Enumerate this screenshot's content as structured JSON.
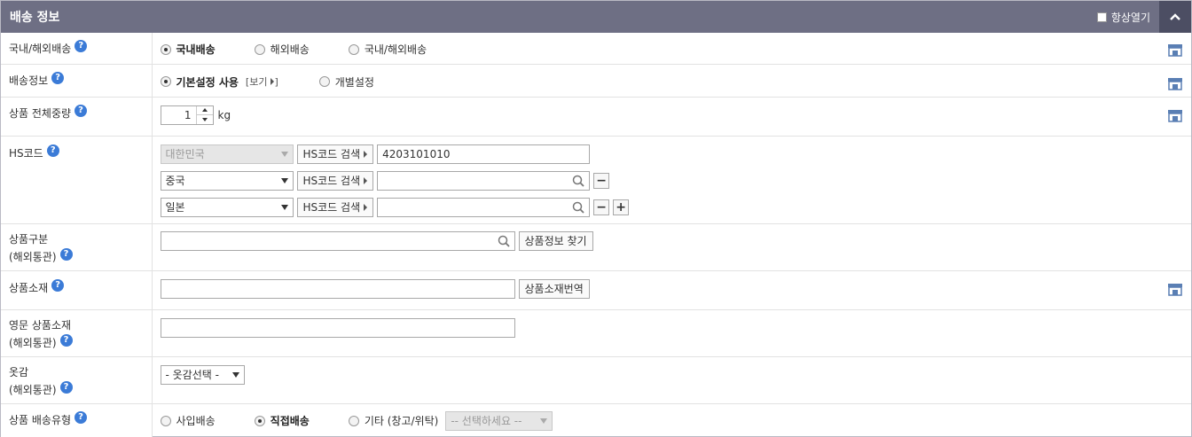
{
  "header": {
    "title": "배송 정보",
    "always_open_label": "항상열기"
  },
  "rows": {
    "shipping_scope": {
      "label": "국내/해외배송",
      "options": [
        "국내배송",
        "해외배송",
        "국내/해외배송"
      ],
      "selected": "국내배송"
    },
    "shipping_info": {
      "label": "배송정보",
      "option_default": "기본설정 사용",
      "view_link": "[보기",
      "option_custom": "개별설정",
      "selected": "기본설정 사용"
    },
    "weight": {
      "label": "상품 전체중량",
      "value": "1",
      "unit": "kg"
    },
    "hs_code": {
      "label": "HS코드",
      "entries": [
        {
          "country": "대한민국",
          "search_label": "HS코드 검색",
          "code": "4203101010"
        },
        {
          "country": "중국",
          "search_label": "HS코드 검색",
          "code": ""
        },
        {
          "country": "일본",
          "search_label": "HS코드 검색",
          "code": ""
        }
      ]
    },
    "product_category": {
      "label_line1": "상품구분",
      "label_line2": "(해외통관)",
      "button": "상품정보 찾기"
    },
    "material": {
      "label": "상품소재",
      "button": "상품소재번역"
    },
    "material_en": {
      "label_line1": "영문 상품소재",
      "label_line2": "(해외통관)"
    },
    "fabric": {
      "label_line1": "옷감",
      "label_line2": "(해외통관)",
      "select_value": "- 옷감선택 -"
    },
    "delivery_type": {
      "label": "상품 배송유형",
      "options": [
        "사입배송",
        "직접배송",
        "기타 (창고/위탁)"
      ],
      "selected": "직접배송",
      "select_value": "-- 선택하세요 --"
    }
  },
  "colors": {
    "header_bg": "#6e6f84",
    "help_blue": "#3b7bd7"
  }
}
